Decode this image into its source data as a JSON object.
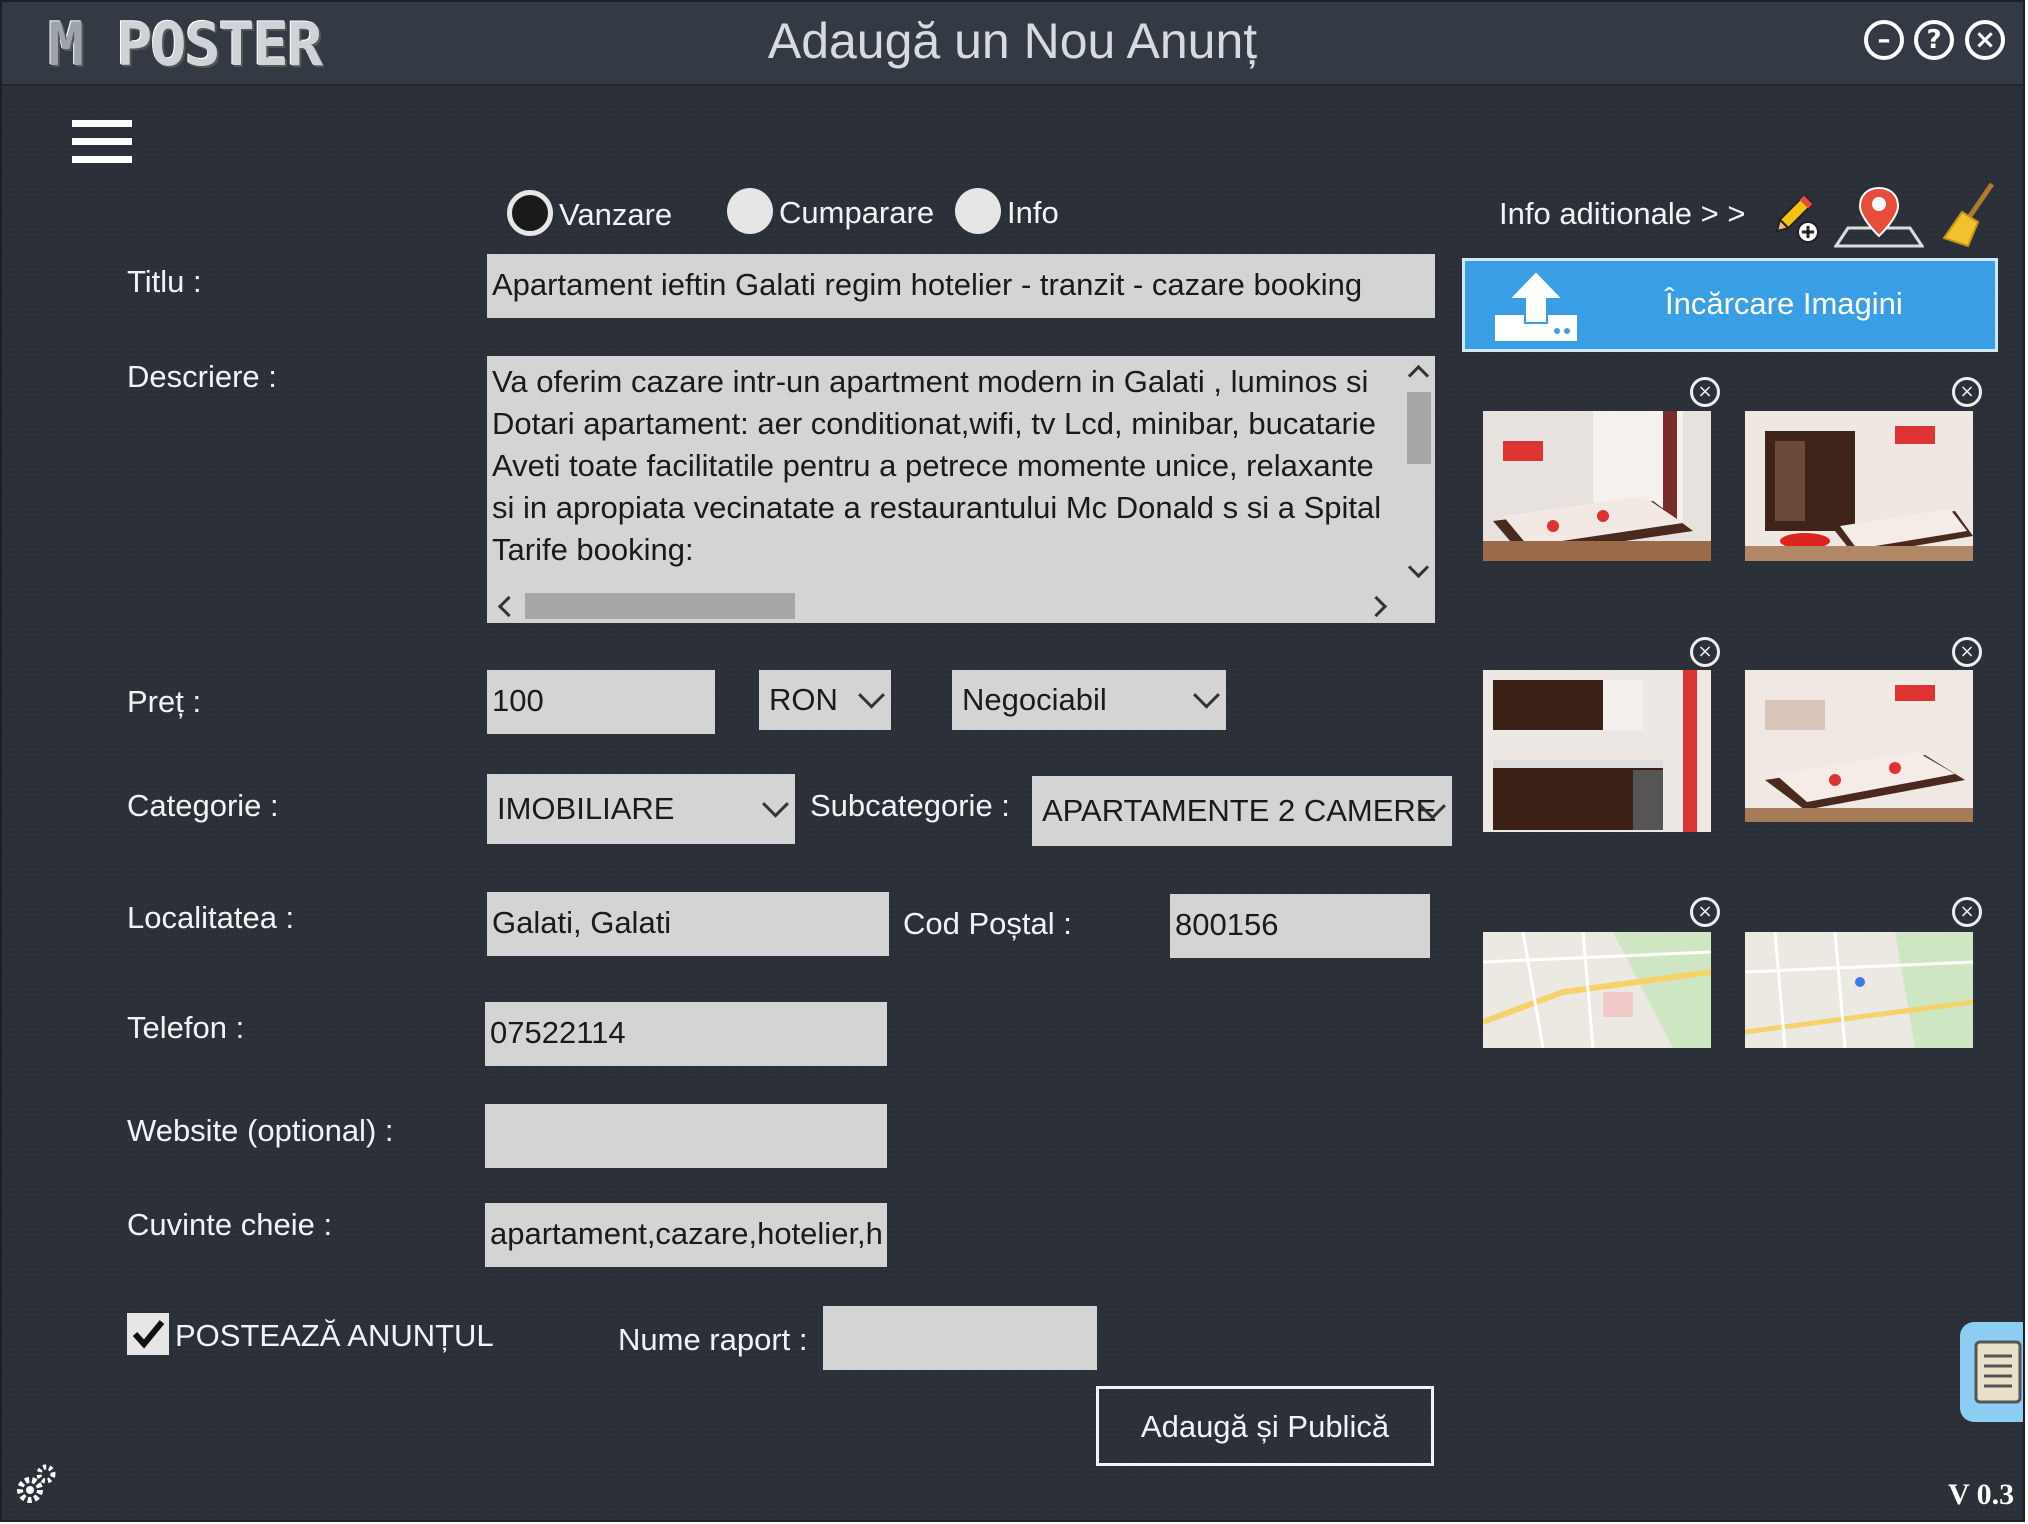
{
  "app": {
    "logo": "POSTER",
    "logo_m": "M",
    "title": "Adaugă un Nou Anunț",
    "version": "V 0.3"
  },
  "window_controls": {
    "minimize": "–",
    "help": "?",
    "close": "×"
  },
  "type_options": [
    {
      "label": "Vanzare",
      "selected": true
    },
    {
      "label": "Cumparare",
      "selected": false
    },
    {
      "label": "Info",
      "selected": false
    }
  ],
  "info_aditionale": "Info aditionale > >",
  "upload_button": "Încărcare Imagini",
  "form": {
    "titlu_label": "Titlu :",
    "titlu_value": "Apartament ieftin Galati regim hotelier - tranzit - cazare booking",
    "descriere_label": "Descriere :",
    "descriere_lines": [
      "Va oferim cazare intr-un apartment modern in Galati , luminos si",
      "Dotari apartament: aer conditionat,wifi, tv Lcd, minibar, bucatarie",
      "Aveti toate facilitatile pentru a petrece momente unice, relaxante",
      "si in apropiata vecinatate a restaurantului Mc Donald s si a Spital",
      "Tarife booking:"
    ],
    "pret_label": "Preț :",
    "pret_value": "100",
    "currency": "RON",
    "negotiable": "Negociabil",
    "categorie_label": "Categorie :",
    "categorie_value": "IMOBILIARE",
    "subcategorie_label": "Subcategorie :",
    "subcategorie_value": "APARTAMENTE 2 CAMERE",
    "localitate_label": "Localitatea :",
    "localitate_value": "Galati, Galati",
    "cod_postal_label": "Cod Poștal :",
    "cod_postal_value": "800156",
    "telefon_label": "Telefon :",
    "telefon_value": "07522114",
    "website_label": "Website (optional) :",
    "website_value": "",
    "cuvinte_label": "Cuvinte cheie :",
    "cuvinte_value": "apartament,cazare,hotelier,h",
    "posteaza_label": "POSTEAZĂ ANUNȚUL",
    "posteaza_checked": true,
    "raport_label": "Nume raport :",
    "raport_value": "",
    "submit_label": "Adaugă și Publică"
  },
  "thumbnails": [
    "bedroom-photo",
    "bedroom-wardrobe-photo",
    "kitchen-photo",
    "bedroom-photo-2",
    "map-photo",
    "map-photo-2"
  ],
  "icons": [
    "menu-icon",
    "edit-add-icon",
    "map-pin-icon",
    "broom-icon",
    "upload-icon",
    "gear-icon",
    "notes-icon"
  ],
  "colors": {
    "background": "#2b3038",
    "field": "#d4d4d4",
    "upload_button": "#3a9ee4",
    "text": "#f2f3f5"
  }
}
